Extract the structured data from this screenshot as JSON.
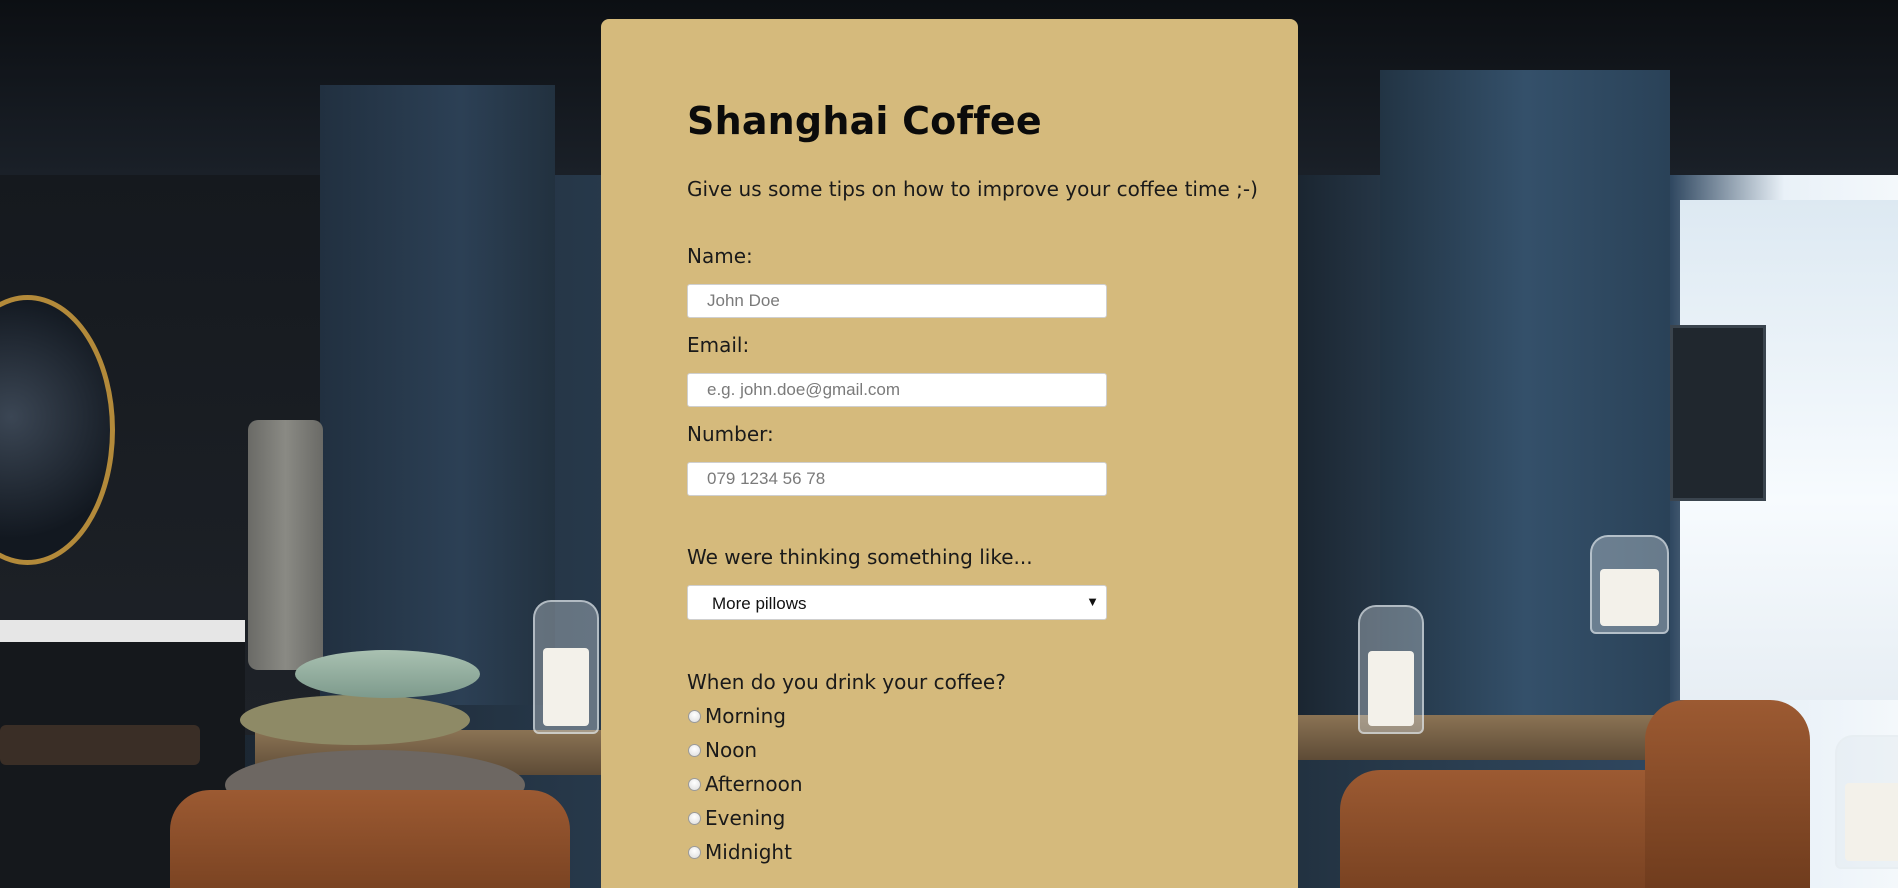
{
  "form": {
    "title": "Shanghai Coffee",
    "subtitle": "Give us some tips on how to improve your coffee time ;-)",
    "name_label": "Name:",
    "name_placeholder": "John Doe",
    "email_label": "Email:",
    "email_placeholder": "e.g. john.doe@gmail.com",
    "number_label": "Number:",
    "number_placeholder": "079 1234 56 78",
    "suggestion_label": "We were thinking something like...",
    "suggestion_selected": "More pillows",
    "dropdown_icon": "caret-down-icon",
    "time_question": "When do you drink your coffee?",
    "time_options": [
      "Morning",
      "Noon",
      "Afternoon",
      "Evening",
      "Midnight"
    ]
  },
  "colors": {
    "card_background": "#d5ba7c",
    "text": "#1a1a1a",
    "input_background": "#ffffff"
  }
}
